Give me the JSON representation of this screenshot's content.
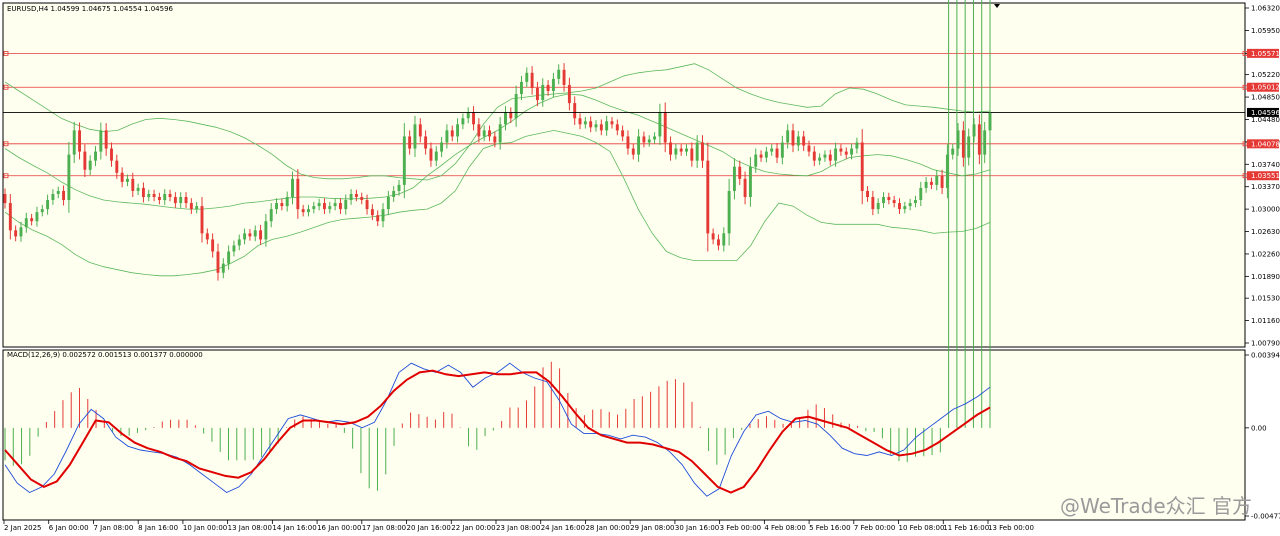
{
  "chart_data": [
    {
      "type": "candlestick",
      "header": "EURUSD,H4  1.04599 1.04675 1.04554 1.04596",
      "y_ticks": [
        "1.06320",
        "1.05950",
        "1.05571",
        "1.05220",
        "1.04850",
        "1.04480",
        "1.04110",
        "1.03740",
        "1.03370",
        "1.03000",
        "1.02630",
        "1.02260",
        "1.01890",
        "1.01530",
        "1.01160",
        "1.00790"
      ],
      "ylim": [
        1.0079,
        1.0632
      ],
      "current_price": {
        "value": 1.04596,
        "label": "1.04596"
      },
      "levels": [
        {
          "value": 1.05571,
          "label": "1.05571"
        },
        {
          "value": 1.05012,
          "label": "1.05012"
        },
        {
          "value": 1.04078,
          "label": "1.04078"
        },
        {
          "value": 1.03551,
          "label": "1.03551"
        }
      ],
      "x_labels": [
        "2 Jan 2025",
        "6 Jan 00:00",
        "7 Jan 08:00",
        "8 Jan 16:00",
        "10 Jan 00:00",
        "13 Jan 08:00",
        "14 Jan 16:00",
        "16 Jan 00:00",
        "17 Jan 08:00",
        "20 Jan 16:00",
        "22 Jan 00:00",
        "23 Jan 08:00",
        "24 Jan 16:00",
        "28 Jan 00:00",
        "29 Jan 08:00",
        "30 Jan 16:00",
        "3 Feb 00:00",
        "4 Feb 08:00",
        "5 Feb 16:00",
        "7 Feb 00:00",
        "10 Feb 08:00",
        "11 Feb 16:00",
        "13 Feb 00:00"
      ],
      "colors": {
        "up": "#4caf50",
        "down": "#e53935",
        "band": "#5cb85c",
        "level": "#e53935",
        "price_line": "#000000"
      },
      "close": [
        1.031,
        1.0265,
        1.0255,
        1.027,
        1.0285,
        1.028,
        1.0295,
        1.03,
        1.0315,
        1.0325,
        1.033,
        1.0315,
        1.039,
        1.043,
        1.0395,
        1.0365,
        1.038,
        1.0395,
        1.043,
        1.04,
        1.038,
        1.036,
        1.0345,
        1.035,
        1.033,
        1.0335,
        1.032,
        1.0325,
        1.032,
        1.0315,
        1.0325,
        1.032,
        1.031,
        1.032,
        1.031,
        1.03,
        1.0305,
        1.026,
        1.025,
        1.023,
        1.0195,
        1.021,
        1.023,
        1.024,
        1.025,
        1.026,
        1.0255,
        1.0265,
        1.025,
        1.028,
        1.03,
        1.031,
        1.0305,
        1.032,
        1.035,
        1.03,
        1.0295,
        1.03,
        1.0305,
        1.031,
        1.03,
        1.0305,
        1.031,
        1.03,
        1.0315,
        1.0325,
        1.032,
        1.0315,
        1.03,
        1.029,
        1.028,
        1.03,
        1.032,
        1.033,
        1.034,
        1.042,
        1.04,
        1.044,
        1.042,
        1.04,
        1.038,
        1.0395,
        1.041,
        1.043,
        1.042,
        1.044,
        1.045,
        1.046,
        1.044,
        1.042,
        1.043,
        1.042,
        1.041,
        1.044,
        1.046,
        1.045,
        1.049,
        1.051,
        1.0525,
        1.05,
        1.048,
        1.0505,
        1.0495,
        1.0515,
        1.053,
        1.0505,
        1.0475,
        1.045,
        1.044,
        1.0445,
        1.0435,
        1.044,
        1.043,
        1.0445,
        1.044,
        1.043,
        1.042,
        1.04,
        1.039,
        1.042,
        1.041,
        1.0415,
        1.042,
        1.046,
        1.041,
        1.039,
        1.04,
        1.0395,
        1.04,
        1.038,
        1.041,
        1.038,
        1.026,
        1.025,
        1.024,
        1.026,
        1.033,
        1.037,
        1.035,
        1.032,
        1.037,
        1.039,
        1.0385,
        1.0395,
        1.04,
        1.0385,
        1.041,
        1.043,
        1.0405,
        1.042,
        1.0405,
        1.0395,
        1.038,
        1.0385,
        1.039,
        1.038,
        1.04,
        1.0395,
        1.039,
        1.04,
        1.041,
        1.033,
        1.032,
        1.03,
        1.031,
        1.032,
        1.0315,
        1.031,
        1.03,
        1.0305,
        1.031,
        1.0315,
        1.0335,
        1.0345,
        1.034,
        1.0355,
        1.0335,
        1.039,
        1.04,
        1.043,
        1.0385,
        1.042,
        1.044,
        1.039,
        1.043,
        1.046
      ],
      "bollinger": {
        "period": 20,
        "upper": [
          1.051,
          1.0495,
          1.048,
          1.0465,
          1.045,
          1.044,
          1.0432,
          1.0428,
          1.043,
          1.044,
          1.0448,
          1.045,
          1.0448,
          1.0445,
          1.044,
          1.0435,
          1.0428,
          1.0418,
          1.0405,
          1.039,
          1.0372,
          1.0358,
          1.0352,
          1.035,
          1.035,
          1.0352,
          1.0355,
          1.0355,
          1.0352,
          1.035,
          1.0348,
          1.0355,
          1.0375,
          1.0405,
          1.044,
          1.0468,
          1.0482,
          1.0485,
          1.0488,
          1.049,
          1.0492,
          1.0495,
          1.05,
          1.051,
          1.052,
          1.0525,
          1.0528,
          1.053,
          1.0535,
          1.054,
          1.053,
          1.0515,
          1.05,
          1.049,
          1.0482,
          1.0476,
          1.0472,
          1.0468,
          1.047,
          1.049,
          1.05,
          1.0498,
          1.049,
          1.048,
          1.0472,
          1.047,
          1.0468,
          1.0465,
          1.0462,
          1.046,
          1.0462
        ],
        "middle": [
          1.04,
          1.0385,
          1.0372,
          1.036,
          1.0345,
          1.0332,
          1.0322,
          1.0315,
          1.0312,
          1.031,
          1.0308,
          1.0305,
          1.0302,
          1.03,
          1.03,
          1.0302,
          1.0305,
          1.031,
          1.0312,
          1.0315,
          1.0318,
          1.032,
          1.032,
          1.0318,
          1.0317,
          1.0317,
          1.0318,
          1.032,
          1.0325,
          1.0335,
          1.0355,
          1.0372,
          1.039,
          1.0405,
          1.0418,
          1.043,
          1.0445,
          1.0462,
          1.0475,
          1.0485,
          1.049,
          1.0488,
          1.048,
          1.047,
          1.0462,
          1.0455,
          1.0445,
          1.0435,
          1.0425,
          1.0415,
          1.0405,
          1.0395,
          1.038,
          1.037,
          1.0362,
          1.0358,
          1.0356,
          1.0355,
          1.0362,
          1.0375,
          1.0385,
          1.0388,
          1.039,
          1.0388,
          1.0382,
          1.0375,
          1.0365,
          1.036,
          1.0355,
          1.0358,
          1.0365
        ],
        "lower": [
          1.0295,
          1.0278,
          1.0265,
          1.0255,
          1.0242,
          1.0225,
          1.0212,
          1.0205,
          1.02,
          1.0195,
          1.0192,
          1.019,
          1.019,
          1.0192,
          1.0195,
          1.02,
          1.021,
          1.0222,
          1.024,
          1.025,
          1.0255,
          1.0262,
          1.027,
          1.0278,
          1.0283,
          1.0285,
          1.0287,
          1.029,
          1.0295,
          1.0298,
          1.03,
          1.031,
          1.033,
          1.037,
          1.04,
          1.0408,
          1.041,
          1.042,
          1.0425,
          1.043,
          1.0425,
          1.042,
          1.041,
          1.0395,
          1.035,
          1.03,
          1.026,
          1.023,
          1.022,
          1.0215,
          1.0215,
          1.0215,
          1.0215,
          1.024,
          1.028,
          1.031,
          1.0305,
          1.029,
          1.0278,
          1.0275,
          1.0275,
          1.0275,
          1.0275,
          1.027,
          1.0268,
          1.0265,
          1.026,
          1.0262,
          1.0263,
          1.0268,
          1.0278
        ]
      }
    },
    {
      "type": "macd",
      "header": "MACD(12,26,9) 0.002572 0.001513 0.001377 0.000000",
      "params": [
        12,
        26,
        9
      ],
      "y_ticks": [
        "0.003945",
        "0.00",
        "-0.004774"
      ],
      "ylim": [
        -0.004774,
        0.003945
      ],
      "colors": {
        "macd": "#1e4dd8",
        "signal": "#e00000",
        "hist_up": "#e53935",
        "hist_down": "#4caf50"
      },
      "macd": [
        -0.002,
        -0.003,
        -0.0035,
        -0.0032,
        -0.0025,
        -0.0012,
        0.0002,
        0.001,
        0.0005,
        -0.0005,
        -0.001,
        -0.0012,
        -0.0013,
        -0.0014,
        -0.0016,
        -0.002,
        -0.0025,
        -0.003,
        -0.0035,
        -0.0032,
        -0.0025,
        -0.0015,
        -0.0005,
        0.0005,
        0.0007,
        0.0005,
        0.0003,
        0.0004,
        0.0003,
        0.0,
        0.0003,
        0.0015,
        0.003,
        0.0035,
        0.0032,
        0.003,
        0.0034,
        0.003,
        0.0022,
        0.0027,
        0.003,
        0.0035,
        0.003,
        0.0027,
        0.0025,
        0.0015,
        0.0002,
        -0.0003,
        -0.0003,
        -0.0004,
        -0.0006,
        -0.0004,
        -0.0005,
        -0.0008,
        -0.0013,
        -0.002,
        -0.003,
        -0.0037,
        -0.0033,
        -0.0015,
        -0.0002,
        0.0007,
        0.0009,
        0.0005,
        0.0003,
        0.0004,
        0.0002,
        -0.0004,
        -0.0011,
        -0.0014,
        -0.0015,
        -0.0013,
        -0.0015,
        -0.0012,
        -0.0005,
        0.0,
        0.0005,
        0.001,
        0.0013,
        0.0017,
        0.0022
      ],
      "signal": [
        -0.0012,
        -0.002,
        -0.0028,
        -0.0032,
        -0.0029,
        -0.002,
        -0.0008,
        0.0004,
        0.0003,
        -0.0003,
        -0.0008,
        -0.0011,
        -0.0013,
        -0.0016,
        -0.0018,
        -0.0022,
        -0.0024,
        -0.0026,
        -0.0027,
        -0.0024,
        -0.0017,
        -0.0008,
        0.0,
        0.0004,
        0.0004,
        0.0003,
        0.0002,
        0.0003,
        0.0006,
        0.0012,
        0.002,
        0.0026,
        0.003,
        0.0031,
        0.0029,
        0.0028,
        0.0029,
        0.003,
        0.0029,
        0.0029,
        0.003,
        0.003,
        0.0025,
        0.0017,
        0.0008,
        0.0,
        -0.0004,
        -0.0006,
        -0.0008,
        -0.0008,
        -0.0009,
        -0.0011,
        -0.0013,
        -0.0018,
        -0.0025,
        -0.0032,
        -0.0035,
        -0.0032,
        -0.0023,
        -0.0012,
        -0.0002,
        0.0005,
        0.0006,
        0.0004,
        0.0002,
        0.0,
        -0.0004,
        -0.0008,
        -0.0012,
        -0.0015,
        -0.0014,
        -0.0012,
        -0.0008,
        -0.0003,
        0.0002,
        0.0007,
        0.0011
      ]
    }
  ],
  "watermark": "@WeTrade众汇 官方"
}
